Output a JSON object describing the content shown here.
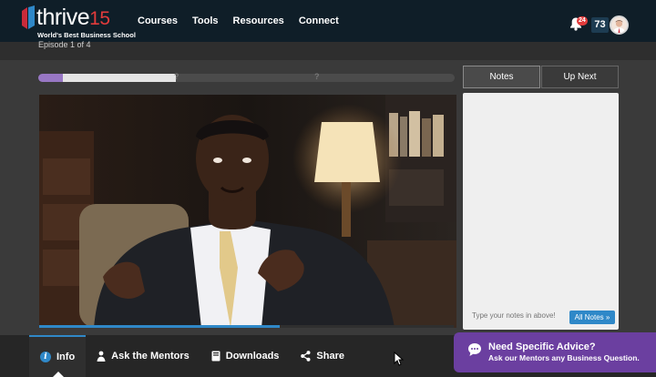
{
  "brand": {
    "word": "thrive",
    "number": "15",
    "tagline": "World's Best Business School",
    "accent": "#e23b3b"
  },
  "nav": {
    "items": [
      "Courses",
      "Tools",
      "Resources",
      "Connect"
    ]
  },
  "header_right": {
    "notification_count": "24",
    "points": "73"
  },
  "episode": {
    "label": "Episode 1 of 4",
    "progress_done": 0.06,
    "progress_current_start": 0.06,
    "progress_current_end": 0.33,
    "unknown_marker": "?"
  },
  "video": {
    "played_fraction": 0.58
  },
  "panel": {
    "tabs": [
      {
        "label": "Notes",
        "active": true
      },
      {
        "label": "Up Next",
        "active": false
      }
    ],
    "notes_placeholder": "Type your notes in above!",
    "all_notes_label": "All Notes »"
  },
  "bottom_tabs": [
    {
      "label": "Info",
      "icon": "info-icon",
      "active": true
    },
    {
      "label": "Ask the Mentors",
      "icon": "person-icon",
      "active": false
    },
    {
      "label": "Downloads",
      "icon": "book-icon",
      "active": false
    },
    {
      "label": "Share",
      "icon": "share-icon",
      "active": false
    }
  ],
  "advice": {
    "title": "Need Specific Advice?",
    "subtitle": "Ask our Mentors any Business Question.",
    "icon": "chat-icon",
    "color": "#6b3fa0"
  },
  "colors": {
    "accent_blue": "#2f88c8",
    "progress_purple": "#9877c4",
    "topbar": "#0f1e28"
  }
}
